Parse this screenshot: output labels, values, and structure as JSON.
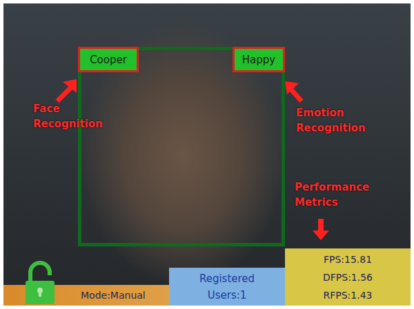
{
  "face": {
    "name": "Cooper",
    "emotion": "Happy"
  },
  "annotations": [
    {
      "label": "Face Recognition"
    },
    {
      "label": "Emotion Recognition"
    },
    {
      "label": "Performance Metrics"
    }
  ],
  "status_bar": {
    "lock": {
      "locked": false
    },
    "mode": "Mode:Manual",
    "registered_users": "Registered Users:1"
  },
  "metrics": [
    {
      "label": "FPS:15.81"
    },
    {
      "label": "DFPS:1.56"
    },
    {
      "label": "RFPS:1.43"
    }
  ]
}
